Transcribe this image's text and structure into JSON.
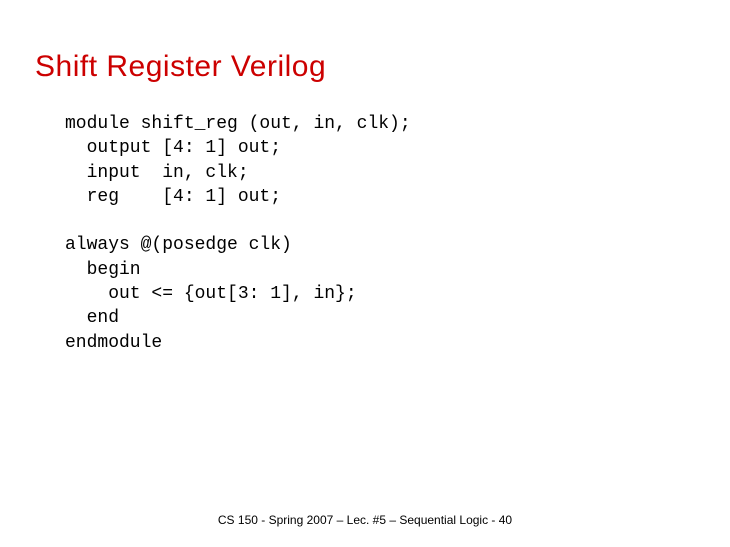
{
  "title": "Shift Register Verilog",
  "code": {
    "l1": "module shift_reg (out, in, clk);",
    "l2": "  output [4: 1] out;",
    "l3": "  input  in, clk;",
    "l4": "  reg    [4: 1] out;",
    "l5": "",
    "l6": "always @(posedge clk)",
    "l7": "  begin",
    "l8": "    out <= {out[3: 1], in};",
    "l9": "  end",
    "l10": "endmodule"
  },
  "footer": "CS 150 - Spring  2007 – Lec. #5 – Sequential Logic - 40"
}
